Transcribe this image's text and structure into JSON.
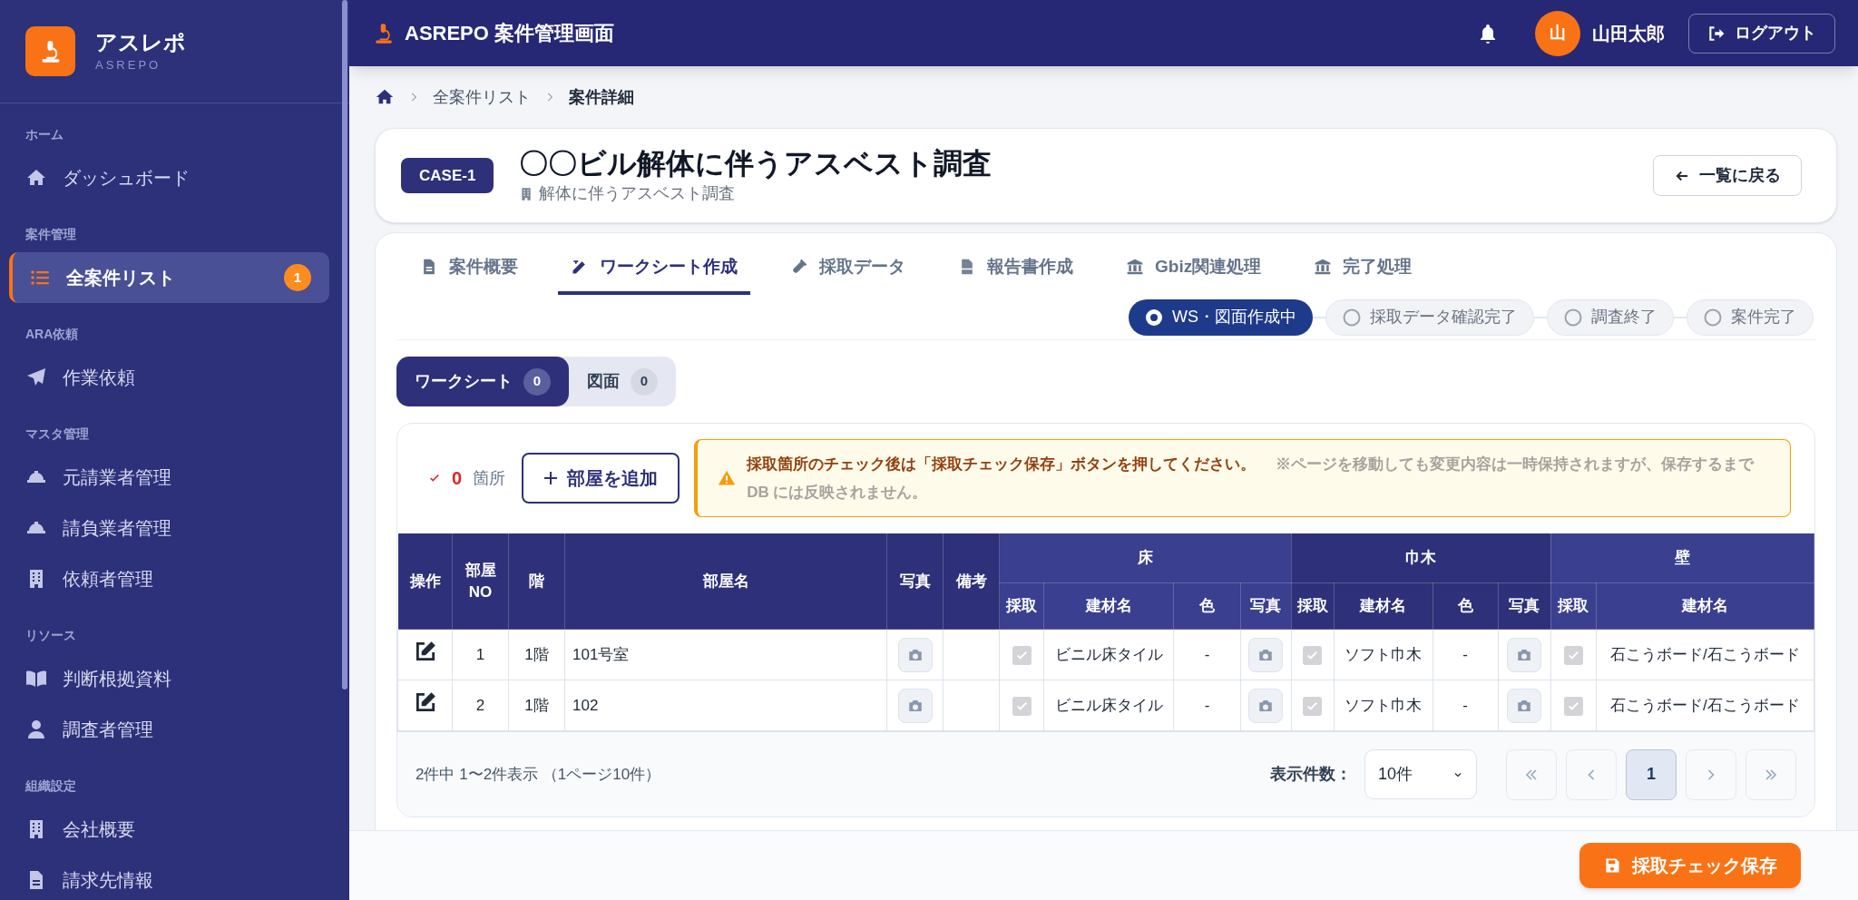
{
  "sidebar": {
    "logo": {
      "title": "アスレポ",
      "subtitle": "ASREPO"
    },
    "sections": [
      {
        "heading": "ホーム",
        "items": [
          {
            "label": "ダッシュボード",
            "selected": false
          }
        ]
      },
      {
        "heading": "案件管理",
        "items": [
          {
            "label": "全案件リスト",
            "selected": true,
            "badge": "1"
          }
        ]
      },
      {
        "heading": "ARA依頼",
        "items": [
          {
            "label": "作業依頼",
            "selected": false
          }
        ]
      },
      {
        "heading": "マスタ管理",
        "items": [
          {
            "label": "元請業者管理",
            "selected": false
          },
          {
            "label": "請負業者管理",
            "selected": false
          },
          {
            "label": "依頼者管理",
            "selected": false
          }
        ]
      },
      {
        "heading": "リソース",
        "items": [
          {
            "label": "判断根拠資料",
            "selected": false
          },
          {
            "label": "調査者管理",
            "selected": false
          }
        ]
      },
      {
        "heading": "組織設定",
        "items": [
          {
            "label": "会社概要",
            "selected": false
          },
          {
            "label": "請求先情報",
            "selected": false
          }
        ]
      }
    ]
  },
  "header": {
    "title": "ASREPO 案件管理画面",
    "user": {
      "initial": "山",
      "name": "山田太郎"
    },
    "logout": "ログアウト"
  },
  "breadcrumb": [
    "全案件リスト",
    "案件詳細"
  ],
  "case": {
    "badge": "CASE-1",
    "title": "〇〇ビル解体に伴うアスベスト調査",
    "subtitle": "解体に伴うアスベスト調査",
    "back": "一覧に戻る"
  },
  "tabs": [
    {
      "label": "案件概要",
      "selected": false
    },
    {
      "label": "ワークシート作成",
      "selected": true
    },
    {
      "label": "採取データ",
      "selected": false
    },
    {
      "label": "報告書作成",
      "selected": false
    },
    {
      "label": "Gbiz関連処理",
      "selected": false
    },
    {
      "label": "完了処理",
      "selected": false
    }
  ],
  "status_steps": [
    {
      "label": "WS・図面作成中",
      "selected": true
    },
    {
      "label": "採取データ確認完了",
      "selected": false
    },
    {
      "label": "調査終了",
      "selected": false
    },
    {
      "label": "案件完了",
      "selected": false
    }
  ],
  "sub_tabs": [
    {
      "label": "ワークシート",
      "count": "0",
      "selected": true
    },
    {
      "label": "図面",
      "count": "0",
      "selected": false
    }
  ],
  "toolbar": {
    "count": "0",
    "count_unit": "箇所",
    "add_button": "部屋を追加"
  },
  "alert": {
    "message": "採取箇所のチェック後は「採取チェック保存」ボタンを押してください。",
    "note": "※ページを移動しても変更内容は一時保持されますが、保存するまで DB には反映されません。"
  },
  "table": {
    "columns": [
      "操作",
      "部屋\nNO",
      "階",
      "部屋名",
      "写真",
      "備考"
    ],
    "groups": [
      {
        "label": "床",
        "columns": [
          "採取",
          "建材名",
          "色",
          "写真"
        ]
      },
      {
        "label": "巾木",
        "columns": [
          "採取",
          "建材名",
          "色",
          "写真"
        ]
      },
      {
        "label": "壁",
        "columns": [
          "採取",
          "建材名"
        ]
      }
    ],
    "rows": [
      {
        "no": "1",
        "floor": "1階",
        "room": "101号室",
        "groups": [
          {
            "checked": true,
            "material": "ビニル床タイル",
            "color_name": "-"
          },
          {
            "checked": true,
            "material": "ソフト巾木",
            "color_name": "-"
          },
          {
            "checked": true,
            "material": "石こうボード/石こうボード"
          }
        ]
      },
      {
        "no": "2",
        "floor": "1階",
        "room": "102",
        "groups": [
          {
            "checked": true,
            "material": "ビニル床タイル",
            "color_name": "-"
          },
          {
            "checked": true,
            "material": "ソフト巾木",
            "color_name": "-"
          },
          {
            "checked": true,
            "material": "石こうボード/石こうボード"
          }
        ]
      }
    ]
  },
  "footer": {
    "summary": "2件中 1〜2件表示 （1ページ10件）",
    "per_page_label": "表示件数：",
    "per_page": "10件",
    "pages": [
      {
        "label": "1",
        "selected": true
      }
    ]
  },
  "save_button": "採取チェック保存"
}
